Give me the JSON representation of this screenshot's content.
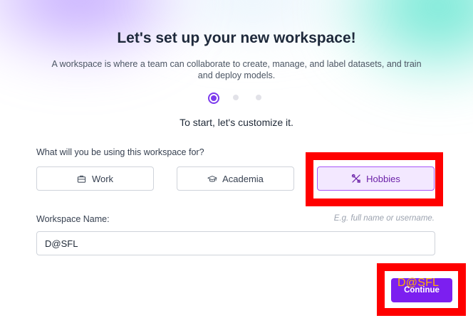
{
  "header": {
    "title": "Let's set up your new workspace!",
    "subtitle": "A workspace is where a team can collaborate to create, manage, and label datasets, and train and deploy models."
  },
  "stepper": {
    "current": 1,
    "total": 3
  },
  "intro": "To start, let's customize it.",
  "usage": {
    "question": "What will you be using this workspace for?",
    "options": [
      {
        "label": "Work",
        "icon": "briefcase-icon",
        "selected": false
      },
      {
        "label": "Academia",
        "icon": "graduation-cap-icon",
        "selected": false
      },
      {
        "label": "Hobbies",
        "icon": "tools-icon",
        "selected": true
      }
    ]
  },
  "workspace_name": {
    "label": "Workspace Name:",
    "hint": "E.g. full name or username.",
    "value": "D@SFL"
  },
  "actions": {
    "continue_label": "Continue"
  },
  "annotation": {
    "overlay_text": "D@SFL",
    "highlight_color": "#ff0000",
    "overlay_text_color": "#ffb000"
  },
  "colors": {
    "accent": "#7c3aed",
    "button": "#7c1ff0",
    "selected_bg": "#f3e8ff",
    "selected_border": "#a855f7"
  }
}
